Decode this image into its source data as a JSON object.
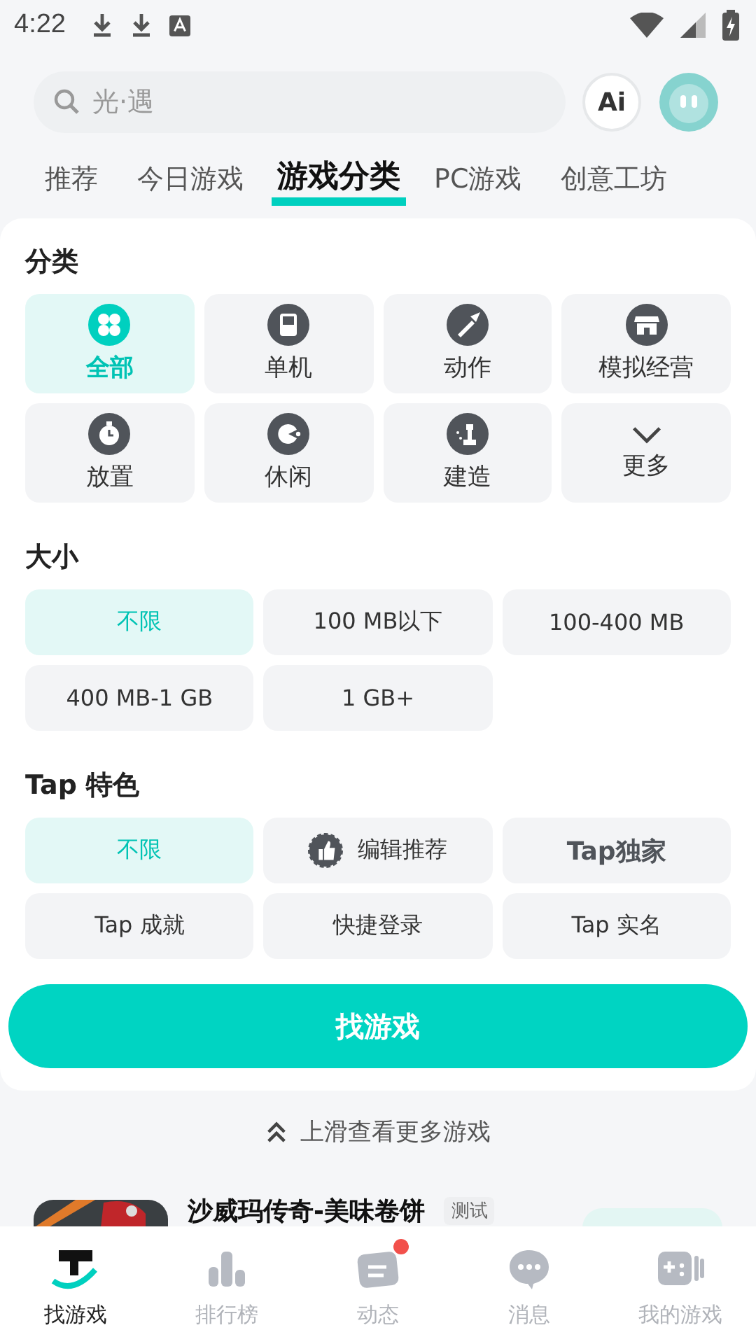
{
  "status_bar": {
    "time": "4:22"
  },
  "search": {
    "placeholder": "光·遇"
  },
  "ai_button": {
    "label": "Ai"
  },
  "tabs": [
    {
      "label": "推荐",
      "selected": false
    },
    {
      "label": "今日游戏",
      "selected": false
    },
    {
      "label": "游戏分类",
      "selected": true
    },
    {
      "label": "PC游戏",
      "selected": false
    },
    {
      "label": "创意工坊",
      "selected": false
    }
  ],
  "category": {
    "title": "分类",
    "items": [
      {
        "label": "全部",
        "selected": true
      },
      {
        "label": "单机",
        "selected": false
      },
      {
        "label": "动作",
        "selected": false
      },
      {
        "label": "模拟经营",
        "selected": false
      },
      {
        "label": "放置",
        "selected": false
      },
      {
        "label": "休闲",
        "selected": false
      },
      {
        "label": "建造",
        "selected": false
      },
      {
        "label": "更多",
        "selected": false
      }
    ]
  },
  "size": {
    "title": "大小",
    "items": [
      {
        "label": "不限",
        "selected": true
      },
      {
        "label": "100 MB以下",
        "selected": false
      },
      {
        "label": "100-400 MB",
        "selected": false
      },
      {
        "label": "400 MB-1 GB",
        "selected": false
      },
      {
        "label": "1 GB+",
        "selected": false
      }
    ]
  },
  "tap_features": {
    "title": "Tap 特色",
    "items": [
      {
        "label": "不限",
        "selected": true,
        "kind": "plain"
      },
      {
        "label": "编辑推荐",
        "selected": false,
        "kind": "badge"
      },
      {
        "label": "Tap独家",
        "selected": false,
        "kind": "logo"
      },
      {
        "label": "Tap 成就",
        "selected": false,
        "kind": "plain"
      },
      {
        "label": "快捷登录",
        "selected": false,
        "kind": "plain"
      },
      {
        "label": "Tap 实名",
        "selected": false,
        "kind": "plain"
      }
    ]
  },
  "find_button": {
    "label": "找游戏"
  },
  "swipe_hint": "上滑查看更多游戏",
  "game": {
    "title": "沙威玛传奇-美味卷饼",
    "tag": "测试"
  },
  "nav": [
    {
      "label": "找游戏",
      "selected": true,
      "dot": false
    },
    {
      "label": "排行榜",
      "selected": false,
      "dot": false
    },
    {
      "label": "动态",
      "selected": false,
      "dot": true
    },
    {
      "label": "消息",
      "selected": false,
      "dot": false
    },
    {
      "label": "我的游戏",
      "selected": false,
      "dot": false
    }
  ]
}
